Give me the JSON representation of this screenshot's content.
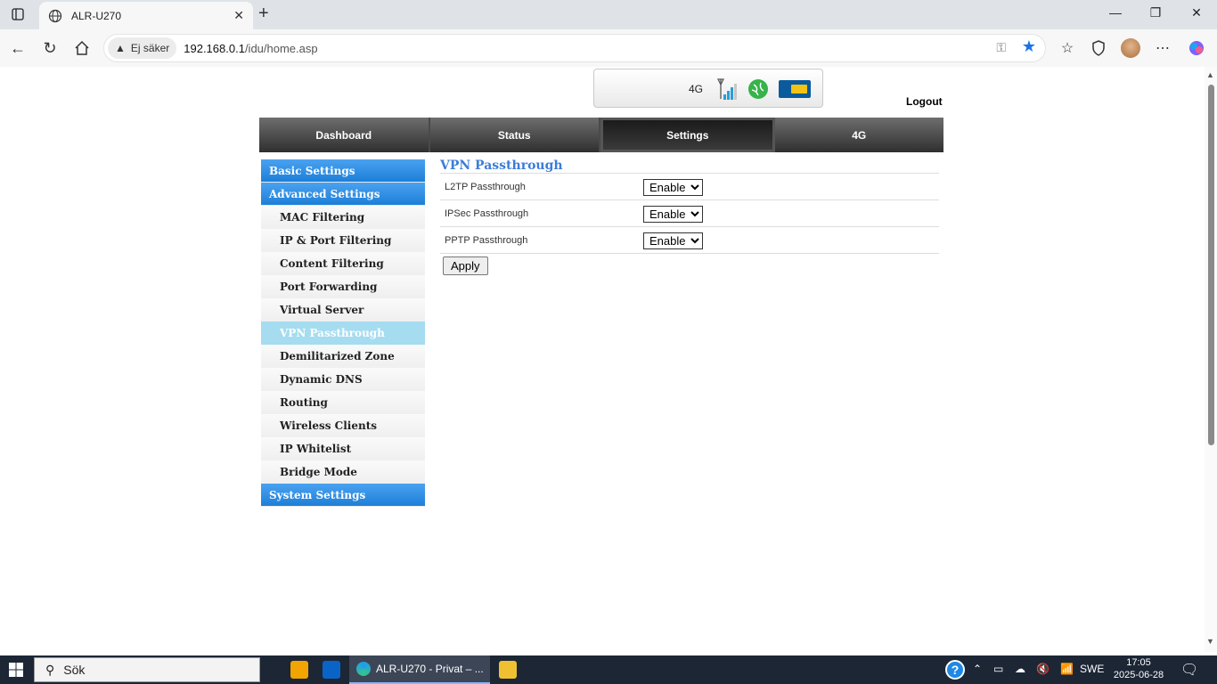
{
  "browser": {
    "tab_title": "ALR-U270",
    "tab_close": "✕",
    "new_tab": "+",
    "not_secure_label": "Ej säker",
    "url_host": "192.168.0.1",
    "url_path": "/idu/home.asp"
  },
  "router": {
    "network_type": "4G",
    "logout_label": "Logout",
    "nav": [
      "Dashboard",
      "Status",
      "Settings",
      "4G"
    ],
    "active_nav": "Settings",
    "sidebar": {
      "basic": "Basic Settings",
      "advanced": "Advanced Settings",
      "items": [
        "MAC Filtering",
        "IP & Port Filtering",
        "Content Filtering",
        "Port Forwarding",
        "Virtual Server",
        "VPN Passthrough",
        "Demilitarized Zone",
        "Dynamic DNS",
        "Routing",
        "Wireless Clients",
        "IP Whitelist",
        "Bridge Mode"
      ],
      "active_item": "VPN Passthrough",
      "system": "System Settings"
    },
    "content": {
      "title": "VPN Passthrough",
      "rows": [
        {
          "label": "L2TP Passthrough",
          "value": "Enable"
        },
        {
          "label": "IPSec Passthrough",
          "value": "Enable"
        },
        {
          "label": "PPTP Passthrough",
          "value": "Enable"
        }
      ],
      "apply_label": "Apply"
    }
  },
  "taskbar": {
    "search_placeholder": "Sök",
    "edge_window_title": "ALR-U270 - Privat – ...",
    "language": "SWE",
    "time": "17:05",
    "date": "2025-06-28"
  }
}
